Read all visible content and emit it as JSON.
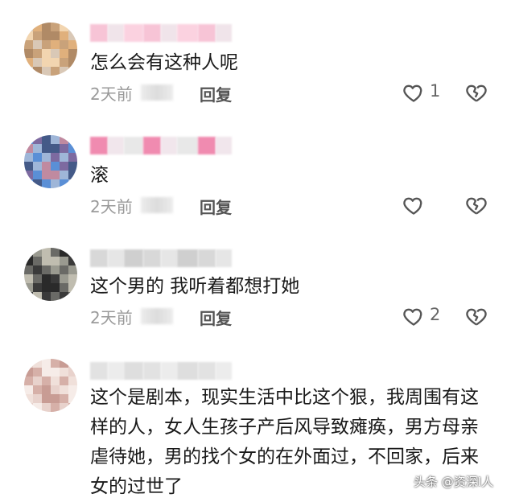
{
  "comments": [
    {
      "text": "怎么会有这种人呢",
      "date": "2天前",
      "reply_label": "回复",
      "like_count": "1",
      "avatar_colors": [
        "#d9c8b6",
        "#c9a27a",
        "#e0b07c",
        "#f2d5b0",
        "#b08a66"
      ],
      "name_colors": [
        "#f7c4d6",
        "#f0e4ea",
        "#fbd2e0"
      ]
    },
    {
      "text": "滚",
      "date": "2天前",
      "reply_label": "回复",
      "like_count": "",
      "avatar_colors": [
        "#5a8fd6",
        "#9fb6d8",
        "#7d6aa0",
        "#c08aa0",
        "#445a88"
      ],
      "name_colors": [
        "#f08bb0",
        "#f1e6ec",
        "#e8e8e8"
      ]
    },
    {
      "text": "这个男的 我听着都想打她",
      "date": "2天前",
      "reply_label": "回复",
      "like_count": "2",
      "avatar_colors": [
        "#3a3a3a",
        "#6a6a66",
        "#9a9a90",
        "#2a2a2a",
        "#c0bdb0"
      ],
      "name_colors": [
        "#d8d8d8",
        "#e6e6e6",
        "#cfcfcf"
      ]
    },
    {
      "text": "这个是剧本，现实生活中比这个狠，我周围有这样的人，女人生孩子产后风导致瘫痪，男方母亲虐待她，男的找个女的在外面过，不回家，后来女的过世了",
      "date": "",
      "reply_label": "",
      "like_count": "",
      "avatar_colors": [
        "#e8d2cc",
        "#d6b0a8",
        "#f0e0da",
        "#c89c94",
        "#f6ece8"
      ],
      "name_colors": [
        "#e2e2e2",
        "#ececec",
        "#dedede"
      ]
    }
  ],
  "watermark": "头条 @资深I人",
  "icons": {
    "like": "heart-outline-icon",
    "dislike": "broken-heart-icon"
  }
}
